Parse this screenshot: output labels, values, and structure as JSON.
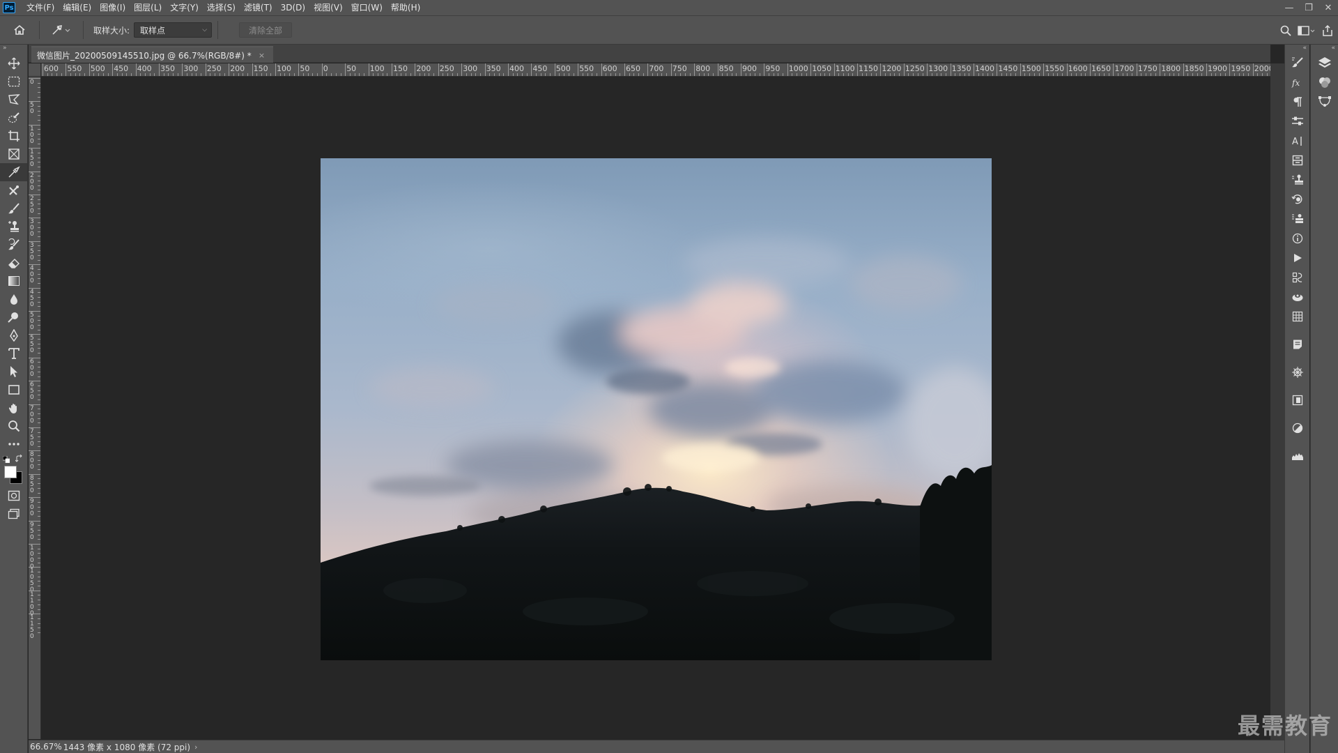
{
  "app": {
    "logo_text": "Ps"
  },
  "menu": {
    "items": [
      {
        "label": "文件(F)"
      },
      {
        "label": "编辑(E)"
      },
      {
        "label": "图像(I)"
      },
      {
        "label": "图层(L)"
      },
      {
        "label": "文字(Y)"
      },
      {
        "label": "选择(S)"
      },
      {
        "label": "滤镜(T)"
      },
      {
        "label": "3D(D)"
      },
      {
        "label": "视图(V)"
      },
      {
        "label": "窗口(W)"
      },
      {
        "label": "帮助(H)"
      }
    ]
  },
  "window_controls": {
    "minimize": "—",
    "restore": "❐",
    "close": "✕"
  },
  "options_bar": {
    "sample_size_label": "取样大小:",
    "sample_size_value": "取样点",
    "clear_all_label": "清除全部"
  },
  "document": {
    "tab_title": "微信图片_20200509145510.jpg @ 66.7%(RGB/8#) *",
    "close_glyph": "×"
  },
  "ruler": {
    "horizontal_labels": [
      "600",
      "550",
      "500",
      "450",
      "400",
      "350",
      "300",
      "250",
      "200",
      "150",
      "100",
      "50",
      "0",
      "50",
      "100",
      "150",
      "200",
      "250",
      "300",
      "350",
      "400",
      "450",
      "500",
      "550",
      "600",
      "650",
      "700",
      "750",
      "800",
      "850",
      "900",
      "950",
      "1000",
      "1050",
      "1100",
      "1150",
      "1200",
      "1250",
      "1300",
      "1350",
      "1400",
      "1450",
      "1500",
      "1550",
      "1600",
      "1650",
      "1700",
      "1750",
      "1800",
      "1850",
      "1900",
      "1950",
      "2000"
    ],
    "vertical_labels": [
      "0",
      "50",
      "100",
      "150",
      "200",
      "250",
      "300",
      "350",
      "400",
      "450",
      "500",
      "550",
      "600",
      "650",
      "700",
      "750",
      "800",
      "850",
      "900",
      "950",
      "1000",
      "1050",
      "1100",
      "1150"
    ]
  },
  "status": {
    "zoom": "66.67%",
    "doc_info": "1443 像素 x 1080 像素 (72 ppi)",
    "arrow": "›"
  },
  "watermark": {
    "text": "最需教育"
  },
  "colors": {
    "foreground": "#ffffff",
    "background": "#000000",
    "ps_blue": "#31a8ff"
  }
}
